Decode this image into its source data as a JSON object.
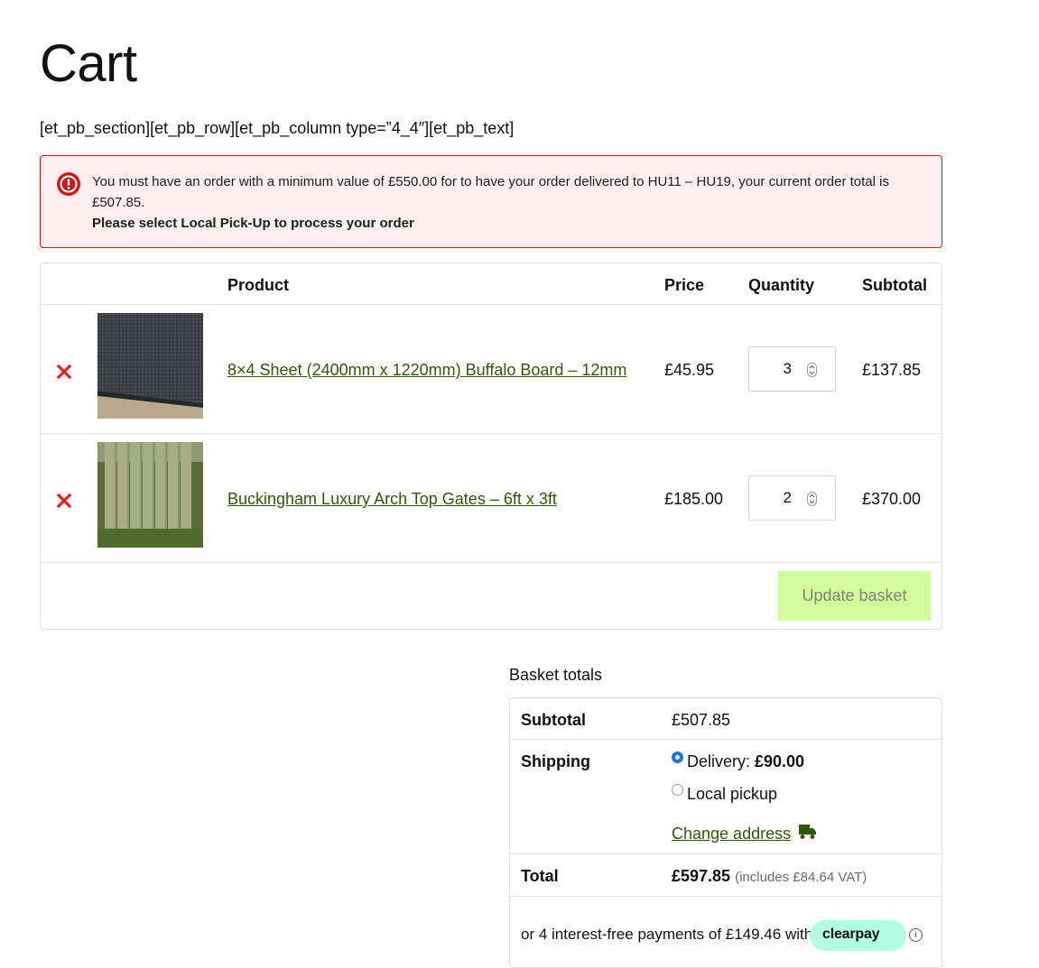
{
  "page": {
    "title": "Cart",
    "shortcode_text": "[et_pb_section][et_pb_row][et_pb_column type=”4_4″][et_pb_text]"
  },
  "notice": {
    "message": "You must have an order with a minimum value of £550.00 for to have your order delivered to HU11 – HU19, your current order total is £507.85.",
    "emphasis": "Please select Local Pick-Up to process your order",
    "icon": "error-icon",
    "color": "#cc1818"
  },
  "cart": {
    "headers": {
      "product": "Product",
      "price": "Price",
      "quantity": "Quantity",
      "subtotal": "Subtotal"
    },
    "items": [
      {
        "name": "8×4 Sheet (2400mm x 1220mm) Buffalo Board – 12mm",
        "price": "£45.95",
        "quantity": "3",
        "subtotal": "£137.85"
      },
      {
        "name": "Buckingham Luxury Arch Top Gates – 6ft x 3ft",
        "price": "£185.00",
        "quantity": "2",
        "subtotal": "£370.00"
      }
    ],
    "update_button": "Update basket",
    "link_color": "#2c5a04",
    "button_color": "#d2fb9c"
  },
  "totals": {
    "heading": "Basket totals",
    "subtotal_label": "Subtotal",
    "subtotal_value": "£507.85",
    "shipping_label": "Shipping",
    "shipping_options": [
      {
        "label": "Delivery: ",
        "price": "£90.00",
        "selected": true
      },
      {
        "label": "Local pickup",
        "selected": false
      }
    ],
    "change_address": "Change address",
    "total_label": "Total",
    "total_value": "£597.85",
    "total_vat": "(includes £84.64 VAT)",
    "clearpay_text": "or 4 interest-free payments of £149.46 with",
    "clearpay_brand": "clearpay",
    "info_glyph": "i"
  }
}
